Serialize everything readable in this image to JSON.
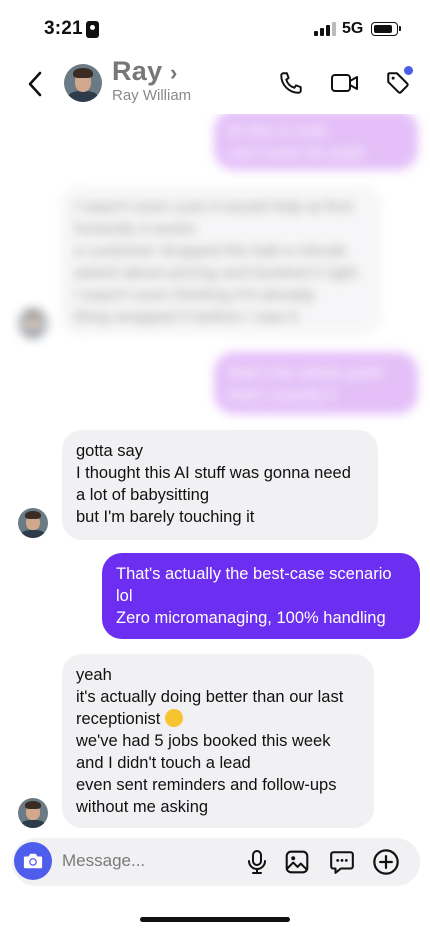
{
  "status_bar": {
    "time": "3:21",
    "network": "5G"
  },
  "header": {
    "name": "Ray",
    "subtitle": "Ray William"
  },
  "messages": [
    {
      "direction": "outgoing",
      "blurred": true,
      "lines": [
        "lol this is nuts",
        "can't even lie yeah"
      ]
    },
    {
      "direction": "incoming",
      "blurred": true,
      "lines": [
        "I wasn't even sure it would help at first",
        "honestly it works",
        "a customer dropped the ball a minute",
        "asked about pricing and booked it right",
        "I wasn't even thinking it'd already",
        "thing wrapped it before I saw it"
      ]
    },
    {
      "direction": "outgoing",
      "blurred": true,
      "lines": [
        "that's the whole point",
        "that's exactly it"
      ]
    },
    {
      "direction": "incoming",
      "blurred": false,
      "lines": [
        "gotta say",
        "I thought this AI stuff was gonna need",
        "a lot of babysitting",
        "but I'm barely touching it"
      ]
    },
    {
      "direction": "outgoing",
      "blurred": false,
      "lines": [
        "That's actually the best-case scenario",
        "lol",
        "Zero micromanaging, 100% handling"
      ]
    },
    {
      "direction": "incoming",
      "blurred": false,
      "lines": [
        "yeah",
        "it's actually doing better than our last",
        "receptionist",
        "we've had 5 jobs booked this week",
        "and I didn't touch a lead",
        "even sent reminders and follow-ups",
        "without me asking"
      ]
    }
  ],
  "composer": {
    "placeholder": "Message..."
  },
  "colors": {
    "accent": "#6c2ef0",
    "camera": "#4f5ded",
    "incoming_bubble": "#f1f1f4"
  }
}
